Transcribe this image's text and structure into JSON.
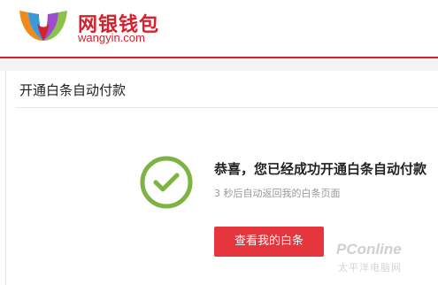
{
  "header": {
    "logo_cn": "网银钱包",
    "logo_en": "wangyin.com",
    "brand_color": "#d6202c"
  },
  "page": {
    "title": "开通白条自动付款"
  },
  "result": {
    "icon": "check-circle-icon",
    "icon_color": "#7cb342",
    "message": "恭喜，您已经成功开通白条自动付款",
    "sub_message": "3 秒后自动返回我的白条页面",
    "button_label": "查看我的白条",
    "button_color": "#e5353d"
  },
  "watermark": {
    "text": "PConline",
    "sub_text": "太平洋电脑网"
  }
}
